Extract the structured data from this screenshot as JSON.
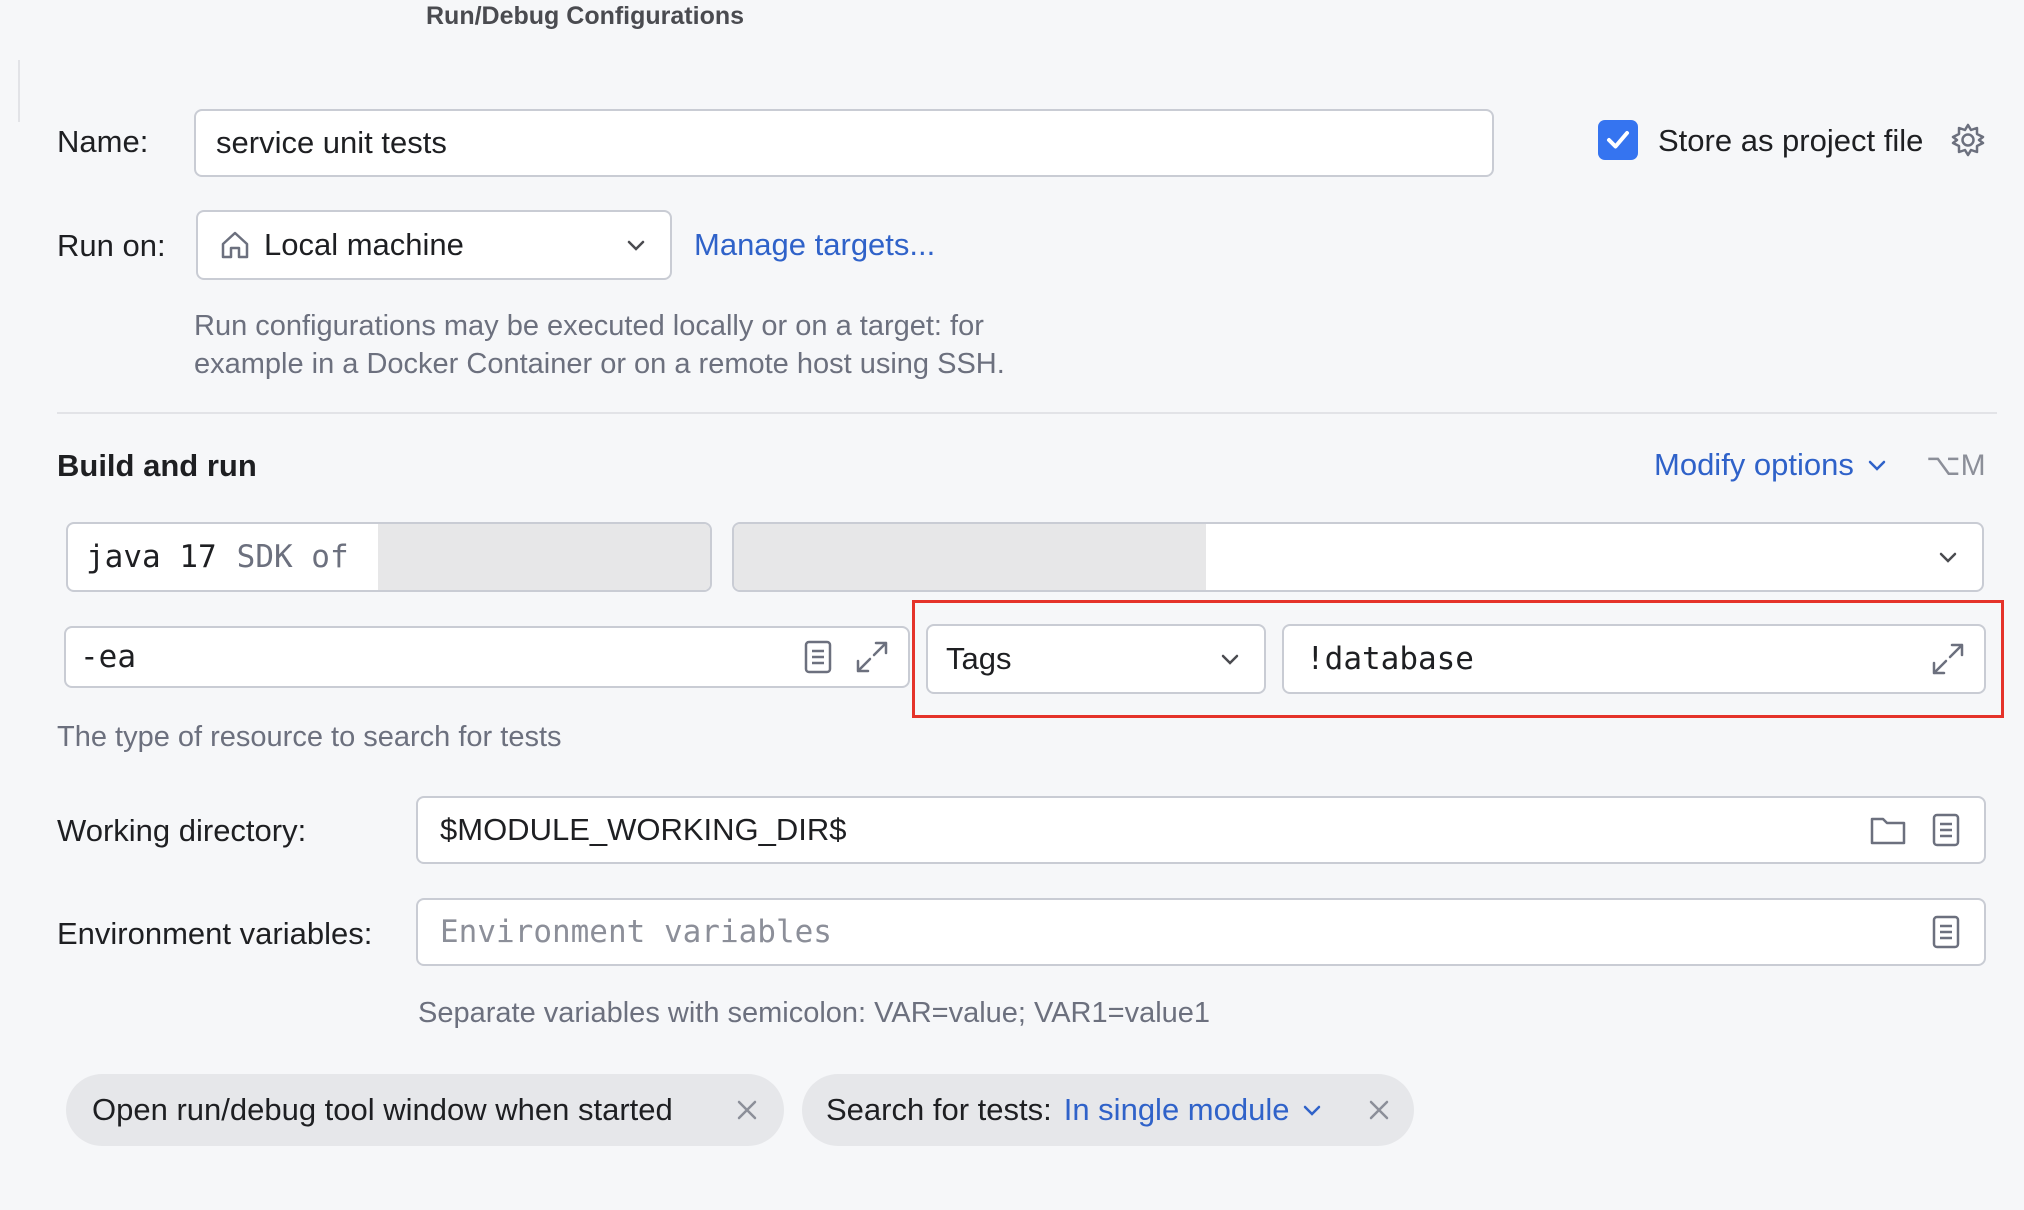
{
  "window": {
    "title": "Run/Debug Configurations"
  },
  "name_row": {
    "label": "Name:",
    "value": "service unit tests",
    "store_checkbox_checked": true,
    "store_label": "Store as project file"
  },
  "run_on": {
    "label": "Run on:",
    "target_value": "Local machine",
    "manage_link": "Manage targets...",
    "hint_line1": "Run configurations may be executed locally or on a target: for",
    "hint_line2": "example in a Docker Container or on a remote host using SSH."
  },
  "build_run": {
    "heading": "Build and run",
    "modify_options": "Modify options",
    "shortcut": "⌥M",
    "jdk_java": "java 17",
    "jdk_sdk": "SDK of",
    "vm_options_value": "-ea",
    "test_kind": "Tags",
    "tag_expression": "!database",
    "hint": "The type of resource to search for tests"
  },
  "working_dir": {
    "label": "Working directory:",
    "value": "$MODULE_WORKING_DIR$"
  },
  "env_vars": {
    "label": "Environment variables:",
    "placeholder": "Environment variables",
    "hint": "Separate variables with semicolon: VAR=value; VAR1=value1"
  },
  "chips": {
    "open_tool_window": "Open run/debug tool window when started",
    "search_label": "Search for tests:",
    "search_value": "In single module"
  },
  "colors": {
    "accent": "#2f62c9",
    "highlight_border": "#e5332a",
    "checkbox": "#3574f0"
  },
  "icons": [
    "gear-icon",
    "home-icon",
    "chevron-down-icon",
    "document-icon",
    "expand-icon",
    "folder-icon",
    "close-icon"
  ]
}
